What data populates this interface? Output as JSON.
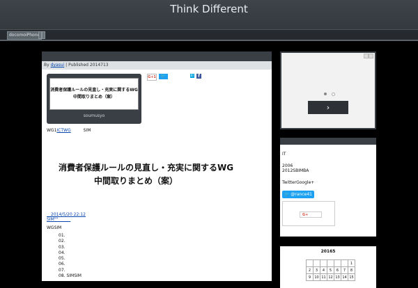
{
  "site": {
    "title": "Think Different"
  },
  "nav": {
    "item": "docomoiPhone"
  },
  "post": {
    "meta_prefix": "By",
    "author": "dyasui",
    "meta_suffix": "| Published 2014713",
    "share": {
      "gplus": "G+1",
      "twitter": "🐦",
      "hatena": "B!",
      "facebook": "f"
    },
    "ogp": {
      "title_line1": "消費者保護ルールの見直し・充実に関するWG",
      "title_line2": "中間取りまとめ（案）",
      "caption": "soumusyo"
    },
    "body_prefix": "WG1",
    "body_link": "ICTWG",
    "body_suffix": "　　　SIM",
    "heading1": "消費者保護ルールの見直し・充実に関するWG",
    "heading2": "中間取りまとめ（案）",
    "date_link": "　2014/5/20 22:12",
    "sim_link": "SIM\"\"　　　",
    "wgsim": "WGSIM",
    "list": [
      "01.",
      "02.",
      "03.",
      "04.",
      "05.",
      "06.",
      "07.",
      "08. SIMSIM"
    ]
  },
  "ad": {
    "next": "›"
  },
  "profile": {
    "line1": "IT",
    "line2": "2006",
    "line3": "2012SBIMBA",
    "line4": "TwitterGoogle+",
    "twitter_handle": "@rance41",
    "gplus_label": "G+"
  },
  "calendar": {
    "title": "20165",
    "row1": [
      "",
      "",
      "",
      "",
      "",
      "",
      "1"
    ],
    "row2": [
      "2",
      "3",
      "4",
      "5",
      "6",
      "7",
      "8"
    ],
    "row3": [
      "9",
      "10",
      "11",
      "12",
      "13",
      "14",
      "15"
    ]
  }
}
